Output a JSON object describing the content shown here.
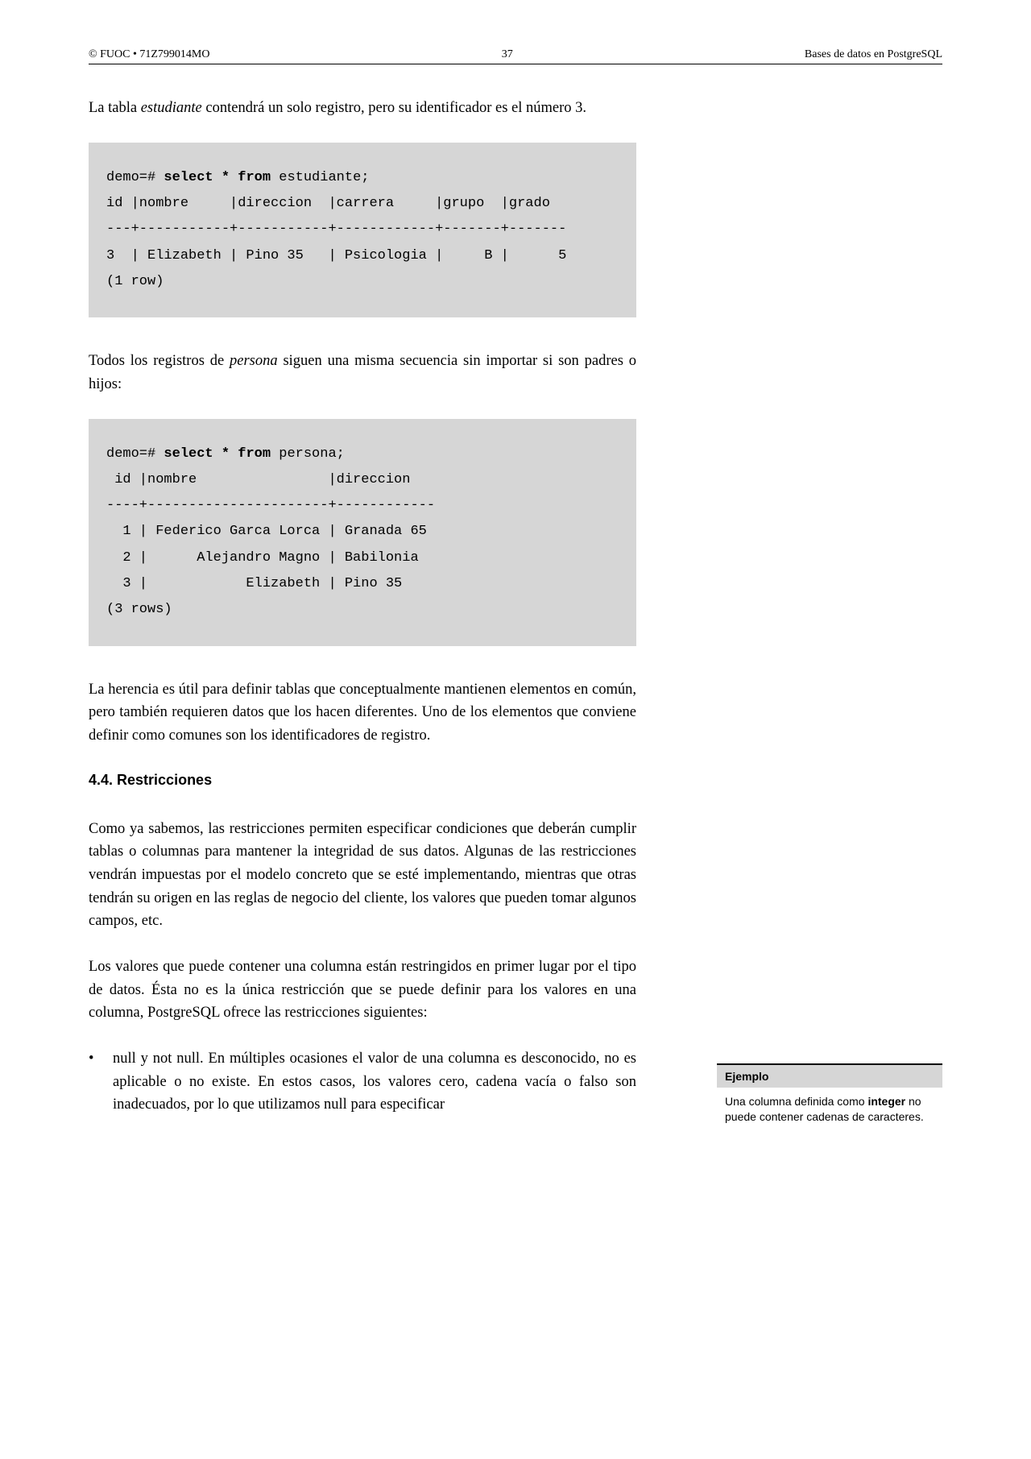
{
  "header": {
    "left": "© FUOC • 71Z799014MO",
    "center": "37",
    "right": "Bases de datos en PostgreSQL"
  },
  "para1_a": "La tabla ",
  "para1_i": "estudiante",
  "para1_b": " contendrá un solo registro, pero su identificador es el número 3.",
  "code1": {
    "prompt": "demo=# ",
    "kw": "select * from",
    "tail": " estudiante;",
    "l2": "id |nombre     |direccion  |carrera     |grupo  |grado",
    "l3": "---+-----------+-----------+------------+-------+-------",
    "l4": "3  | Elizabeth | Pino 35   | Psicologia |     B |      5",
    "l5": "(1 row)"
  },
  "para2_a": "Todos los registros de ",
  "para2_i": "persona",
  "para2_b": " siguen una misma secuencia sin importar si son padres o hijos:",
  "code2": {
    "prompt": "demo=# ",
    "kw": "select * from",
    "tail": " persona;",
    "l2": " id |nombre                |direccion",
    "l3": "----+----------------------+------------",
    "l4": "  1 | Federico Garca Lorca | Granada 65",
    "l5": "  2 |      Alejandro Magno | Babilonia",
    "l6": "  3 |            Elizabeth | Pino 35",
    "l7": "(3 rows)"
  },
  "para3": "La herencia es útil para definir tablas que conceptualmente mantienen elementos en común, pero también requieren datos que los hacen diferentes. Uno de los elementos que conviene definir como comunes son los identificadores de registro.",
  "section": "4.4.  Restricciones",
  "para4": "Como ya sabemos, las restricciones permiten especificar condiciones que deberán cumplir tablas o columnas para mantener la integridad de sus datos. Algunas de las restricciones vendrán impuestas por el modelo concreto que se esté implementando, mientras que otras tendrán su origen en las reglas de negocio del cliente, los valores que pueden tomar algunos campos, etc.",
  "para5": "Los valores que puede contener una columna están restringidos en primer lugar por el tipo de datos. Ésta no es la única restricción que se puede definir para los valores en una columna, PostgreSQL ofrece las restricciones siguientes:",
  "bullet": {
    "mark": "•",
    "b1": "null",
    "t1": " y ",
    "b2": "not null",
    "t2": ". En múltiples ocasiones el valor de una columna es desconocido, no es aplicable o no existe. En estos casos, los valores cero, cadena vacía o falso son inadecuados, por lo que utilizamos ",
    "b3": "null",
    "t3": " para especificar"
  },
  "sidebar": {
    "title": "Ejemplo",
    "a": "Una columna definida como ",
    "b": "integer",
    "c": " no puede contener cadenas de caracteres."
  }
}
